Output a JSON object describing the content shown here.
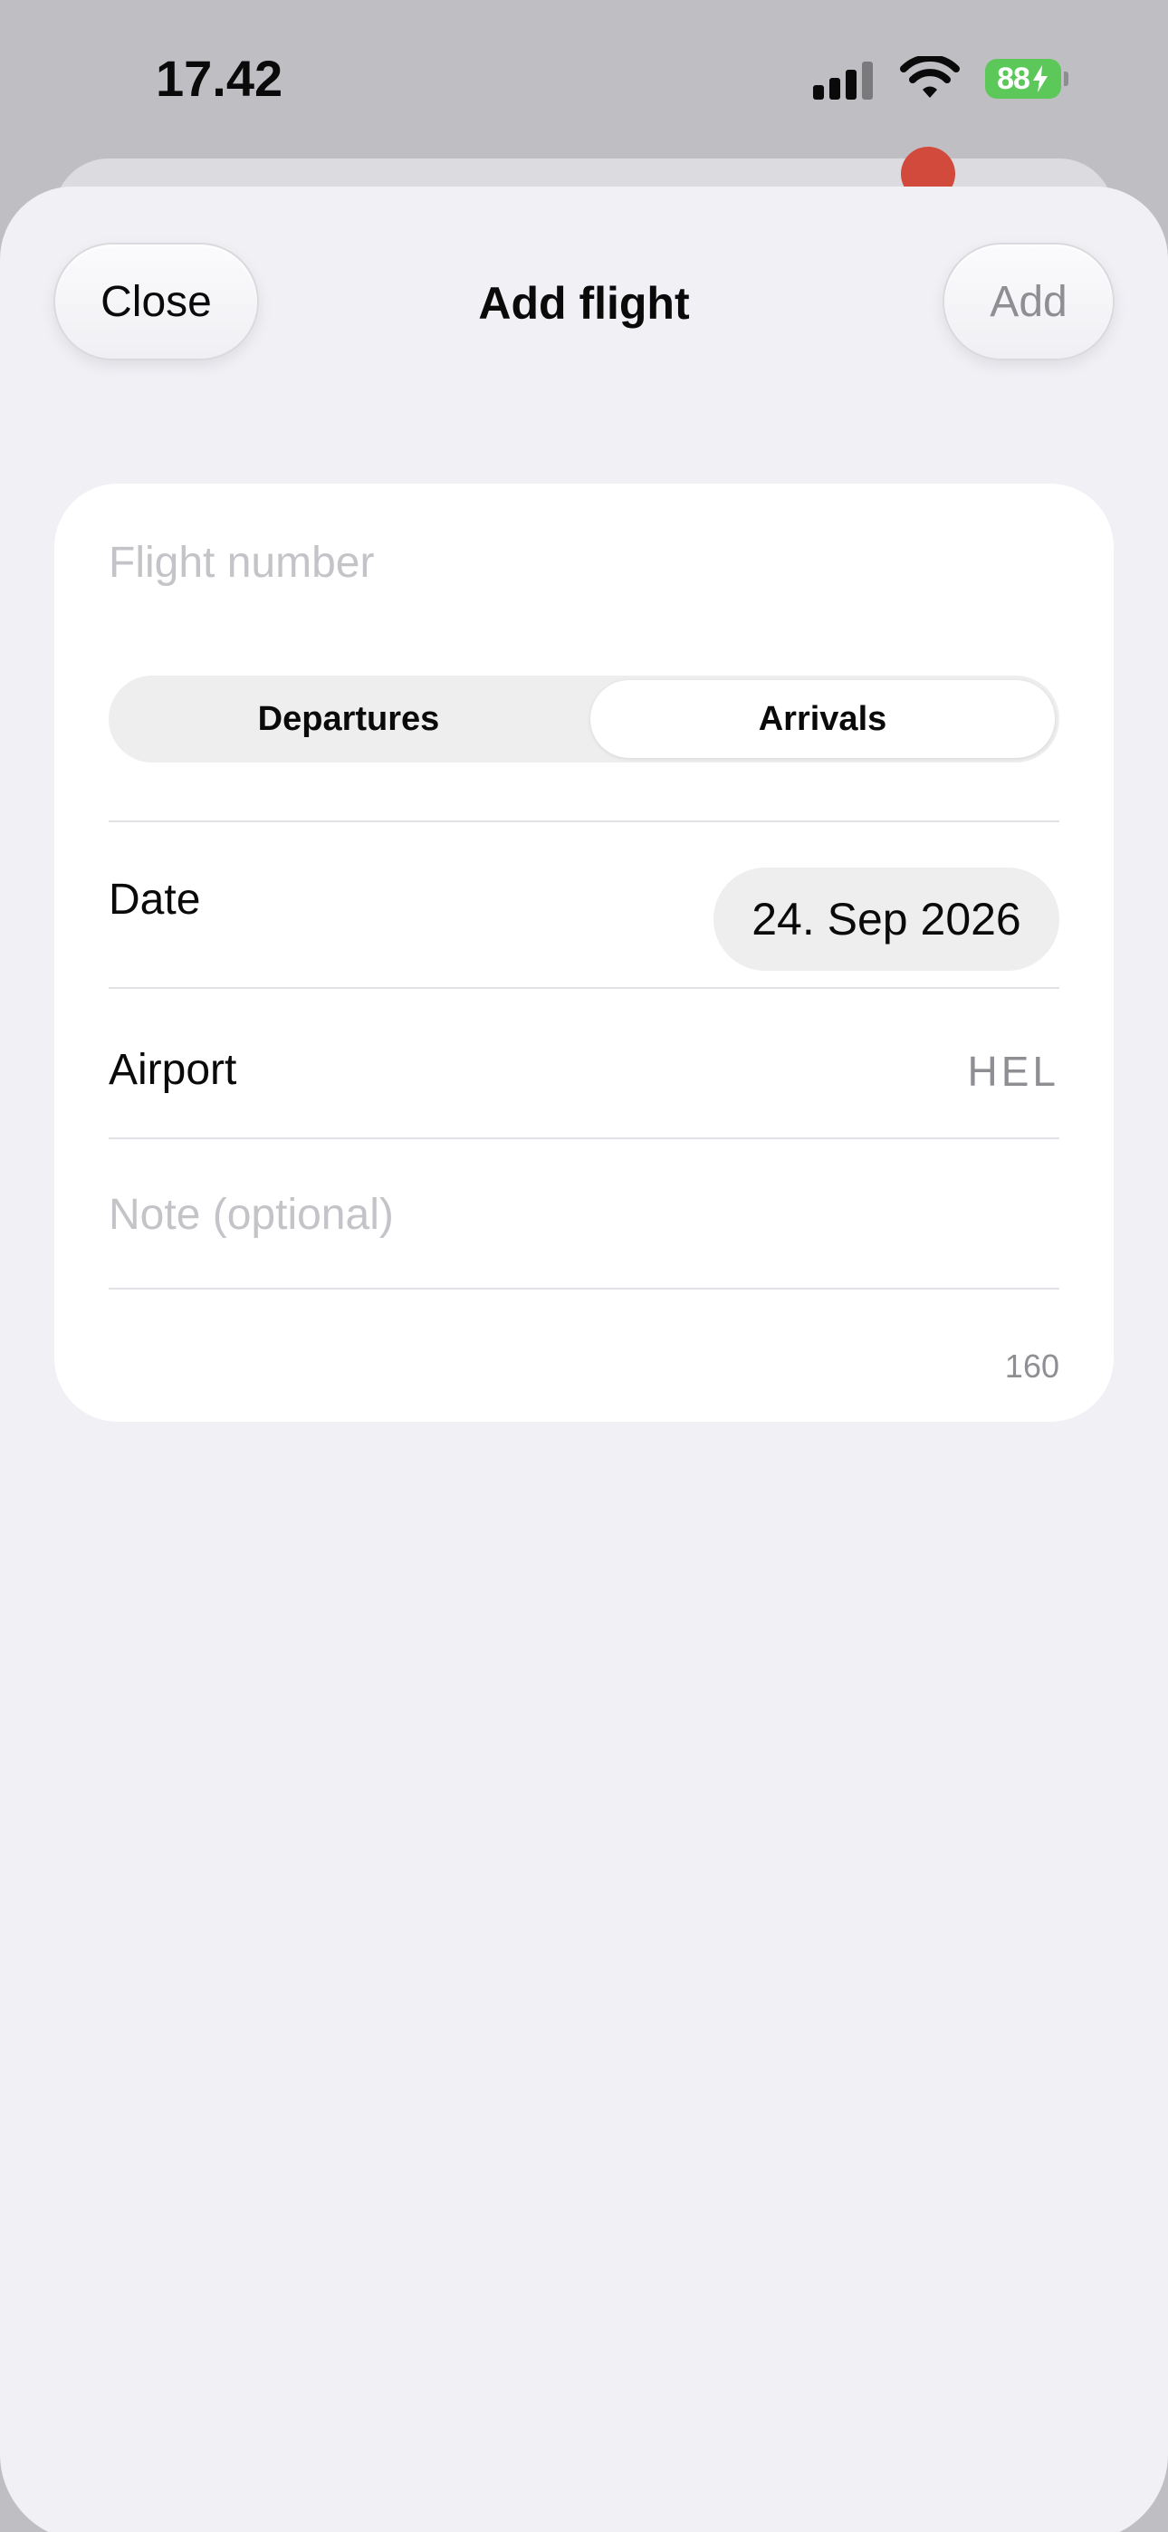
{
  "status_bar": {
    "time": "17.42",
    "battery_level": "88"
  },
  "sheet": {
    "title": "Add flight",
    "close_label": "Close",
    "add_label": "Add"
  },
  "form": {
    "flight_number_placeholder": "Flight number",
    "segments": {
      "departures": "Departures",
      "arrivals": "Arrivals",
      "selected": "Arrivals"
    },
    "date_label": "Date",
    "date_value": "24. Sep 2026",
    "airport_label": "Airport",
    "airport_value": "HEL",
    "note_placeholder": "Note (optional)",
    "note_char_count": "160"
  },
  "colors": {
    "battery": "#5cc85a",
    "sheet_bg": "#f0f0f5",
    "card_bg": "#ffffff"
  }
}
